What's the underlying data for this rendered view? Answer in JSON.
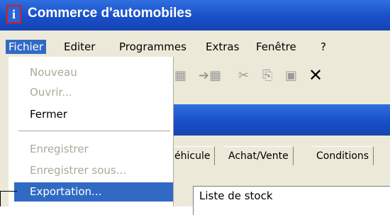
{
  "window": {
    "title": "Commerce d'automobiles",
    "app_icon_glyph": "i",
    "colors": {
      "titlebar": "#1a4fc8",
      "menu_highlight": "#316ac5",
      "icon_border": "#d42020"
    }
  },
  "menubar": {
    "items": [
      {
        "label": "Fichier",
        "active": true
      },
      {
        "label": "Editer"
      },
      {
        "label": "Programmes"
      },
      {
        "label": "Extras"
      },
      {
        "label": "Fenêtre"
      },
      {
        "label": "?"
      }
    ]
  },
  "toolbar": {
    "icons": [
      "save-as-icon",
      "import-icon",
      "cut-icon",
      "copy-icon",
      "paste-icon",
      "delete-icon"
    ],
    "glyphs": [
      "▦",
      "➔▦",
      "✂",
      "⎘",
      "▣",
      "✕"
    ]
  },
  "file_menu": {
    "items": [
      {
        "label": "Nouveau",
        "enabled": false
      },
      {
        "label": "Ouvrir...",
        "enabled": false
      },
      {
        "label": "Fermer",
        "enabled": true
      },
      {
        "label": "Enregistrer",
        "enabled": false
      },
      {
        "label": "Enregistrer sous...",
        "enabled": false
      },
      {
        "label": "Exportation...",
        "enabled": true,
        "selected": true
      }
    ]
  },
  "tabs": [
    "éhicule",
    "Achat/Vente",
    "Conditions"
  ],
  "panel": {
    "label": "Liste de stock"
  }
}
